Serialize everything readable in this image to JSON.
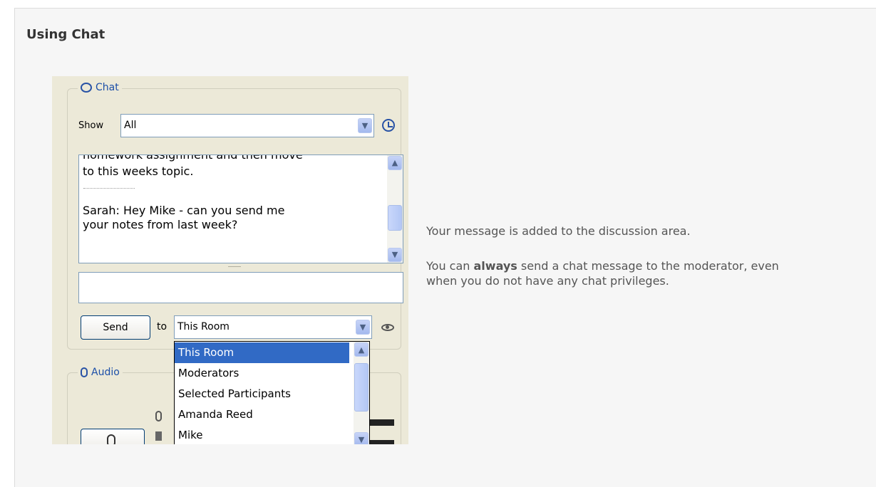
{
  "page": {
    "heading": "Using Chat"
  },
  "chat_panel": {
    "legend": "Chat",
    "show_label": "Show",
    "show_value": "All",
    "messages": {
      "partial_line": "homework assignment and then move",
      "line2": "to this weeks topic.",
      "sarah": "Sarah: Hey Mike - can you send me\nyour notes from last week?"
    },
    "input_value": "",
    "send_label": "Send",
    "to_label": "to",
    "to_value": "This Room",
    "recipient_options": [
      "This Room",
      "Moderators",
      "Selected Participants",
      "Amanda Reed",
      "Mike"
    ],
    "selected_option": "This Room"
  },
  "audio_panel": {
    "legend": "Audio"
  },
  "description": {
    "line1": "Your message is added to the discussion area.",
    "line2_before": "You can ",
    "line2_bold": "always",
    "line2_after": " send a chat message to the moderator, even when you do not have any chat privileges."
  },
  "icons": {
    "chat": "chat-bubble-icon",
    "history": "clock-icon",
    "dropdown": "chevron-down-icon",
    "scroll_up": "chevron-up-icon",
    "scroll_down": "chevron-down-icon",
    "privacy": "eye-icon",
    "audio": "microphone-icon"
  },
  "colors": {
    "panel_bg": "#ece9d8",
    "accent": "#1c4fa8",
    "selection": "#316ac5",
    "page_bg": "#f6f6f6"
  }
}
